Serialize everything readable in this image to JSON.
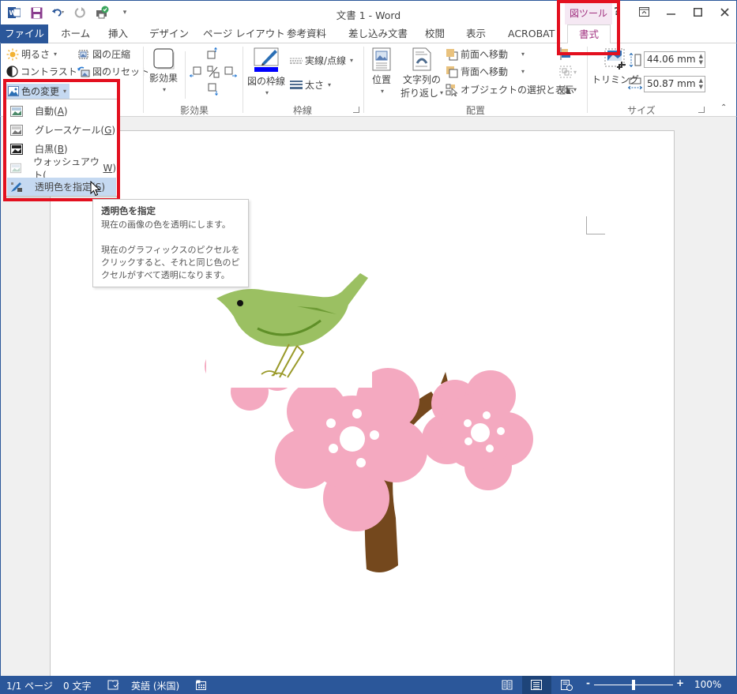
{
  "window": {
    "title": "文書 1 - Word",
    "context_tool_label": "図ツール",
    "help": "?",
    "controls": {
      "ribbon_display": "ribbon-display-icon",
      "minimize": "minimize-icon",
      "maximize": "maximize-icon",
      "close": "close-icon"
    }
  },
  "qat": {
    "icons": [
      "word-logo-icon",
      "save-icon",
      "undo-icon",
      "redo-icon",
      "check-compat-icon",
      "customize-qat-icon"
    ]
  },
  "tabs": [
    {
      "label": "ファイル",
      "name": "file"
    },
    {
      "label": "ホーム",
      "name": "home"
    },
    {
      "label": "挿入",
      "name": "insert"
    },
    {
      "label": "デザイン",
      "name": "design"
    },
    {
      "label": "ページ レイアウト",
      "name": "page-layout"
    },
    {
      "label": "参考資料",
      "name": "references"
    },
    {
      "label": "差し込み文書",
      "name": "mailings"
    },
    {
      "label": "校閲",
      "name": "review"
    },
    {
      "label": "表示",
      "name": "view"
    },
    {
      "label": "ACROBAT",
      "name": "acrobat"
    },
    {
      "label": "書式",
      "name": "format",
      "active": true
    }
  ],
  "ribbon": {
    "adjust": {
      "brightness": "明るさ",
      "contrast": "コントラスト",
      "color": "色の変更",
      "compress": "図の圧縮",
      "reset": "図のリセット"
    },
    "shadow": {
      "shadow_effects": "影効果",
      "group_label": "影効果"
    },
    "border": {
      "picture_border": "図の枠線",
      "dashes": "実線/点線",
      "weight": "太さ",
      "group_label": "枠線",
      "border_color": "#0000ff"
    },
    "arrange": {
      "position": "位置",
      "wrap_text_line1": "文字列の",
      "wrap_text_line2": "折り返し",
      "bring_forward": "前面へ移動",
      "send_backward": "背面へ移動",
      "selection_pane": "オブジェクトの選択と表示",
      "group_label": "配置"
    },
    "size": {
      "crop": "トリミング",
      "height": "44.06 mm",
      "width": "50.87 mm",
      "group_label": "サイズ"
    }
  },
  "color_menu": {
    "items": [
      {
        "label": "自動(",
        "key": "A",
        "close": ")",
        "icon": "auto-color-icon"
      },
      {
        "label": "グレースケール(",
        "key": "G",
        "close": ")",
        "icon": "grayscale-icon"
      },
      {
        "label": "白黒(",
        "key": "B",
        "close": ")",
        "icon": "black-white-icon"
      },
      {
        "label": "ウォッシュアウト(",
        "key": "W",
        "close": ")",
        "icon": "washout-icon"
      },
      {
        "label": "透明色を指定(",
        "key": "S",
        "close": ")",
        "icon": "set-transparent-color-icon",
        "hovered": true
      }
    ]
  },
  "tooltip": {
    "title": "透明色を指定",
    "line1": "現在の画像の色を透明にします。",
    "line2": "現在のグラフィックスのピクセルをクリックすると、それと同じ色のピクセルがすべて透明になります。"
  },
  "status": {
    "page": "1/1 ページ",
    "words": "0 文字",
    "language": "英語 (米国)",
    "zoom": "100%",
    "zoom_minus": "-",
    "zoom_plus": "+",
    "zoom_level_percent": 100
  },
  "colors": {
    "word_blue": "#2b579a",
    "context_purple": "#a0307f",
    "highlight_red": "#e3101f",
    "blossom_pink": "#f4a9c0",
    "bird_green": "#9bc062",
    "branch_brown": "#74481d"
  }
}
